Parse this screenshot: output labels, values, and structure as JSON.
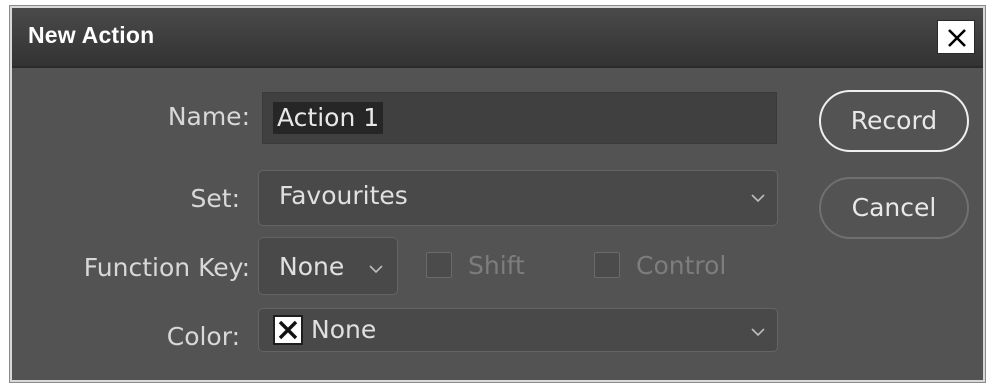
{
  "dialog": {
    "title": "New Action",
    "close_symbol": "×"
  },
  "fields": {
    "name_label": "Name:",
    "name_value": "Action 1",
    "set_label": "Set:",
    "set_value": "Favourites",
    "function_key_label": "Function Key:",
    "function_key_value": "None",
    "shift_label": "Shift",
    "control_label": "Control",
    "color_label": "Color:",
    "color_value": "None"
  },
  "buttons": {
    "record": "Record",
    "cancel": "Cancel"
  },
  "icons": {
    "close": "close-icon",
    "dropdown": "chevron-down-icon",
    "color_none": "x-box-icon"
  },
  "colors": {
    "dialog_bg": "#535353",
    "titlebar_bg": "#3c3c3c",
    "text": "#d8d8d8",
    "disabled_text": "#7d7d7d"
  }
}
